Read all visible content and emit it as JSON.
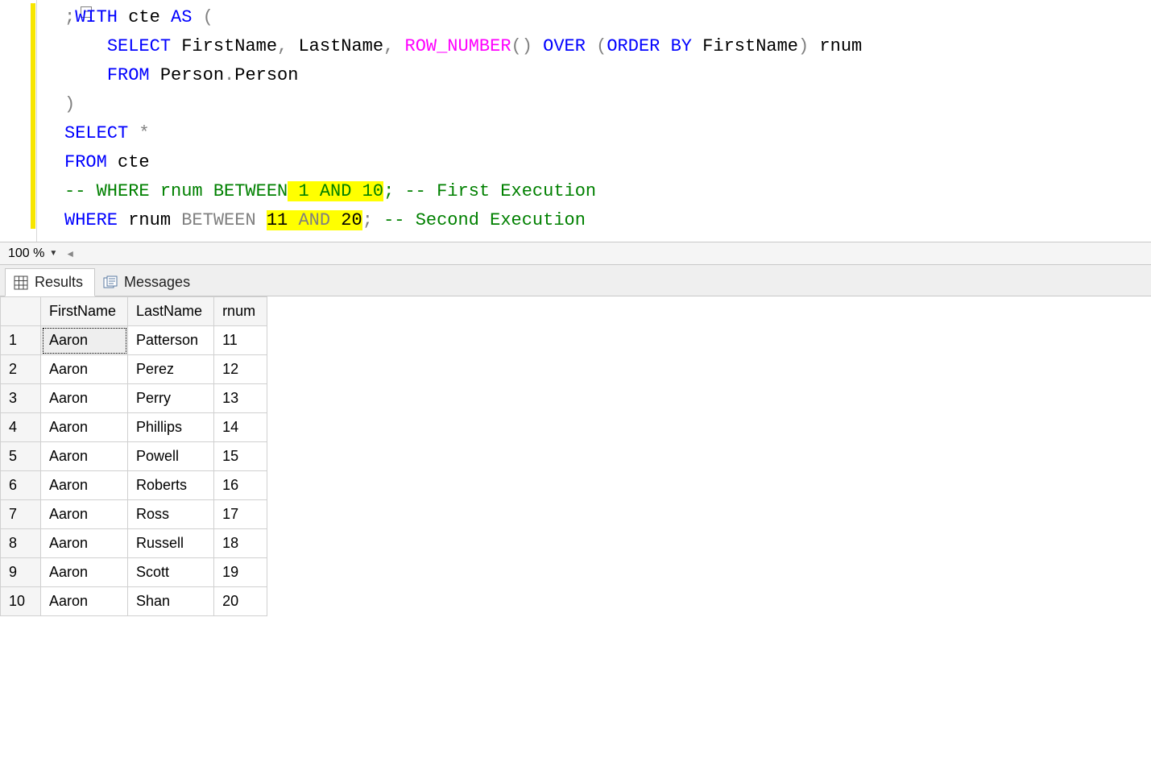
{
  "editor": {
    "fold_glyph": "−",
    "lines": [
      {
        "indent": 0,
        "tokens": [
          {
            "t": ";",
            "c": "kw-gray"
          },
          {
            "t": "WITH",
            "c": "kw-blue"
          },
          {
            "t": " cte ",
            "c": "txt"
          },
          {
            "t": "AS",
            "c": "kw-blue"
          },
          {
            "t": " ",
            "c": "txt"
          },
          {
            "t": "(",
            "c": "kw-gray"
          }
        ]
      },
      {
        "indent": 1,
        "tokens": [
          {
            "t": "SELECT",
            "c": "kw-blue"
          },
          {
            "t": " FirstName",
            "c": "txt"
          },
          {
            "t": ",",
            "c": "kw-gray"
          },
          {
            "t": " LastName",
            "c": "txt"
          },
          {
            "t": ",",
            "c": "kw-gray"
          },
          {
            "t": " ",
            "c": "txt"
          },
          {
            "t": "ROW_NUMBER",
            "c": "kw-pink"
          },
          {
            "t": "()",
            "c": "kw-gray"
          },
          {
            "t": " ",
            "c": "txt"
          },
          {
            "t": "OVER",
            "c": "kw-blue"
          },
          {
            "t": " ",
            "c": "txt"
          },
          {
            "t": "(",
            "c": "kw-gray"
          },
          {
            "t": "ORDER",
            "c": "kw-blue"
          },
          {
            "t": " ",
            "c": "txt"
          },
          {
            "t": "BY",
            "c": "kw-blue"
          },
          {
            "t": " FirstName",
            "c": "txt"
          },
          {
            "t": ")",
            "c": "kw-gray"
          },
          {
            "t": " rnum",
            "c": "txt"
          }
        ]
      },
      {
        "indent": 1,
        "tokens": [
          {
            "t": "FROM",
            "c": "kw-blue"
          },
          {
            "t": " Person",
            "c": "txt"
          },
          {
            "t": ".",
            "c": "kw-gray"
          },
          {
            "t": "Person",
            "c": "txt"
          }
        ]
      },
      {
        "indent": 0,
        "tokens": [
          {
            "t": ")",
            "c": "kw-gray"
          }
        ]
      },
      {
        "indent": 0,
        "tokens": [
          {
            "t": "SELECT",
            "c": "kw-blue"
          },
          {
            "t": " ",
            "c": "txt"
          },
          {
            "t": "*",
            "c": "kw-gray"
          }
        ]
      },
      {
        "indent": 0,
        "tokens": [
          {
            "t": "FROM",
            "c": "kw-blue"
          },
          {
            "t": " cte",
            "c": "txt"
          }
        ]
      },
      {
        "indent": 0,
        "tokens": [
          {
            "t": "-- WHERE rnum BETWEEN",
            "c": "kw-green"
          },
          {
            "t": " 1 AND 10",
            "c": "kw-green",
            "hl": true
          },
          {
            "t": "; -- First Execution",
            "c": "kw-green"
          }
        ]
      },
      {
        "indent": 0,
        "tokens": [
          {
            "t": "WHERE",
            "c": "kw-blue"
          },
          {
            "t": " rnum ",
            "c": "txt"
          },
          {
            "t": "BETWEEN",
            "c": "kw-gray"
          },
          {
            "t": " ",
            "c": "txt"
          },
          {
            "t": "11",
            "c": "txt",
            "hl": true
          },
          {
            "t": " ",
            "c": "txt",
            "hl": true
          },
          {
            "t": "AND",
            "c": "kw-gray",
            "hl": true
          },
          {
            "t": " ",
            "c": "txt",
            "hl": true
          },
          {
            "t": "20",
            "c": "txt",
            "hl": true
          },
          {
            "t": ";",
            "c": "kw-gray"
          },
          {
            "t": " ",
            "c": "txt"
          },
          {
            "t": "-- Second Execution",
            "c": "kw-green"
          }
        ]
      }
    ]
  },
  "zoom": {
    "value": "100 %"
  },
  "tabs": {
    "results": "Results",
    "messages": "Messages"
  },
  "results": {
    "columns": [
      "FirstName",
      "LastName",
      "rnum"
    ],
    "rows": [
      {
        "n": "1",
        "c": [
          "Aaron",
          "Patterson",
          "11"
        ]
      },
      {
        "n": "2",
        "c": [
          "Aaron",
          "Perez",
          "12"
        ]
      },
      {
        "n": "3",
        "c": [
          "Aaron",
          "Perry",
          "13"
        ]
      },
      {
        "n": "4",
        "c": [
          "Aaron",
          "Phillips",
          "14"
        ]
      },
      {
        "n": "5",
        "c": [
          "Aaron",
          "Powell",
          "15"
        ]
      },
      {
        "n": "6",
        "c": [
          "Aaron",
          "Roberts",
          "16"
        ]
      },
      {
        "n": "7",
        "c": [
          "Aaron",
          "Ross",
          "17"
        ]
      },
      {
        "n": "8",
        "c": [
          "Aaron",
          "Russell",
          "18"
        ]
      },
      {
        "n": "9",
        "c": [
          "Aaron",
          "Scott",
          "19"
        ]
      },
      {
        "n": "10",
        "c": [
          "Aaron",
          "Shan",
          "20"
        ]
      }
    ]
  }
}
